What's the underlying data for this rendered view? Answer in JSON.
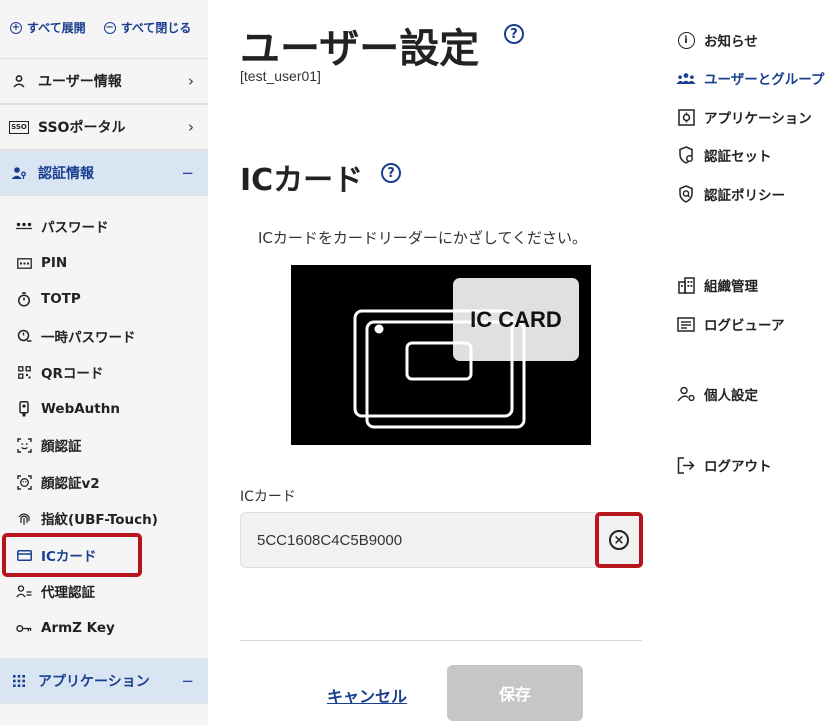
{
  "sidebar": {
    "expand_all": "すべて展開",
    "collapse_all": "すべて閉じる",
    "sections": {
      "user_info": {
        "label": "ユーザー情報",
        "trail": "›"
      },
      "sso_portal": {
        "label": "SSOポータル",
        "trail": "›",
        "icon_text": "SSO"
      },
      "auth_info": {
        "label": "認証情報",
        "trail": "−"
      },
      "applications": {
        "label": "アプリケーション",
        "trail": "−"
      }
    },
    "auth_items": [
      {
        "label": "パスワード",
        "icon": "password-dots-icon"
      },
      {
        "label": "PIN",
        "icon": "pin-pad-icon"
      },
      {
        "label": "TOTP",
        "icon": "timer-icon"
      },
      {
        "label": "一時パスワード",
        "icon": "temp-password-icon"
      },
      {
        "label": "QRコード",
        "icon": "qr-code-icon"
      },
      {
        "label": "WebAuthn",
        "icon": "security-key-icon"
      },
      {
        "label": "顔認証",
        "icon": "face-scan-icon"
      },
      {
        "label": "顔認証v2",
        "icon": "face-scan-v2-icon"
      },
      {
        "label": "指紋(UBF-Touch)",
        "icon": "fingerprint-icon"
      },
      {
        "label": "ICカード",
        "icon": "card-icon"
      },
      {
        "label": "代理認証",
        "icon": "proxy-user-icon"
      },
      {
        "label": "ArmZ Key",
        "icon": "key-icon"
      }
    ]
  },
  "main": {
    "page_title": "ユーザー設定",
    "user_id": "[test_user01]",
    "section_title": "ICカード",
    "instruction": "ICカードをカードリーダーにかざしてください。",
    "card_image_text": "IC CARD",
    "field_label": "ICカード",
    "field_value": "5CC1608C4C5B9000",
    "cancel_label": "キャンセル",
    "save_label": "保存"
  },
  "right_nav": {
    "items": [
      {
        "label": "お知らせ",
        "icon": "info-icon"
      },
      {
        "label": "ユーザーとグループ",
        "icon": "users-icon"
      },
      {
        "label": "アプリケーション",
        "icon": "app-icon"
      },
      {
        "label": "認証セット",
        "icon": "shield-gear-icon"
      },
      {
        "label": "認証ポリシー",
        "icon": "shield-search-icon"
      },
      {
        "label": "組織管理",
        "icon": "building-icon"
      },
      {
        "label": "ログビューア",
        "icon": "log-viewer-icon"
      },
      {
        "label": "個人設定",
        "icon": "user-gear-icon"
      },
      {
        "label": "ログアウト",
        "icon": "logout-icon"
      }
    ]
  },
  "colors": {
    "accent": "#1a3f8f",
    "highlight_border": "#b8141e",
    "sidebar_bg": "#f5f5f5",
    "active_section_bg": "#d9e5f3",
    "disabled_button": "#c6c6c6"
  }
}
